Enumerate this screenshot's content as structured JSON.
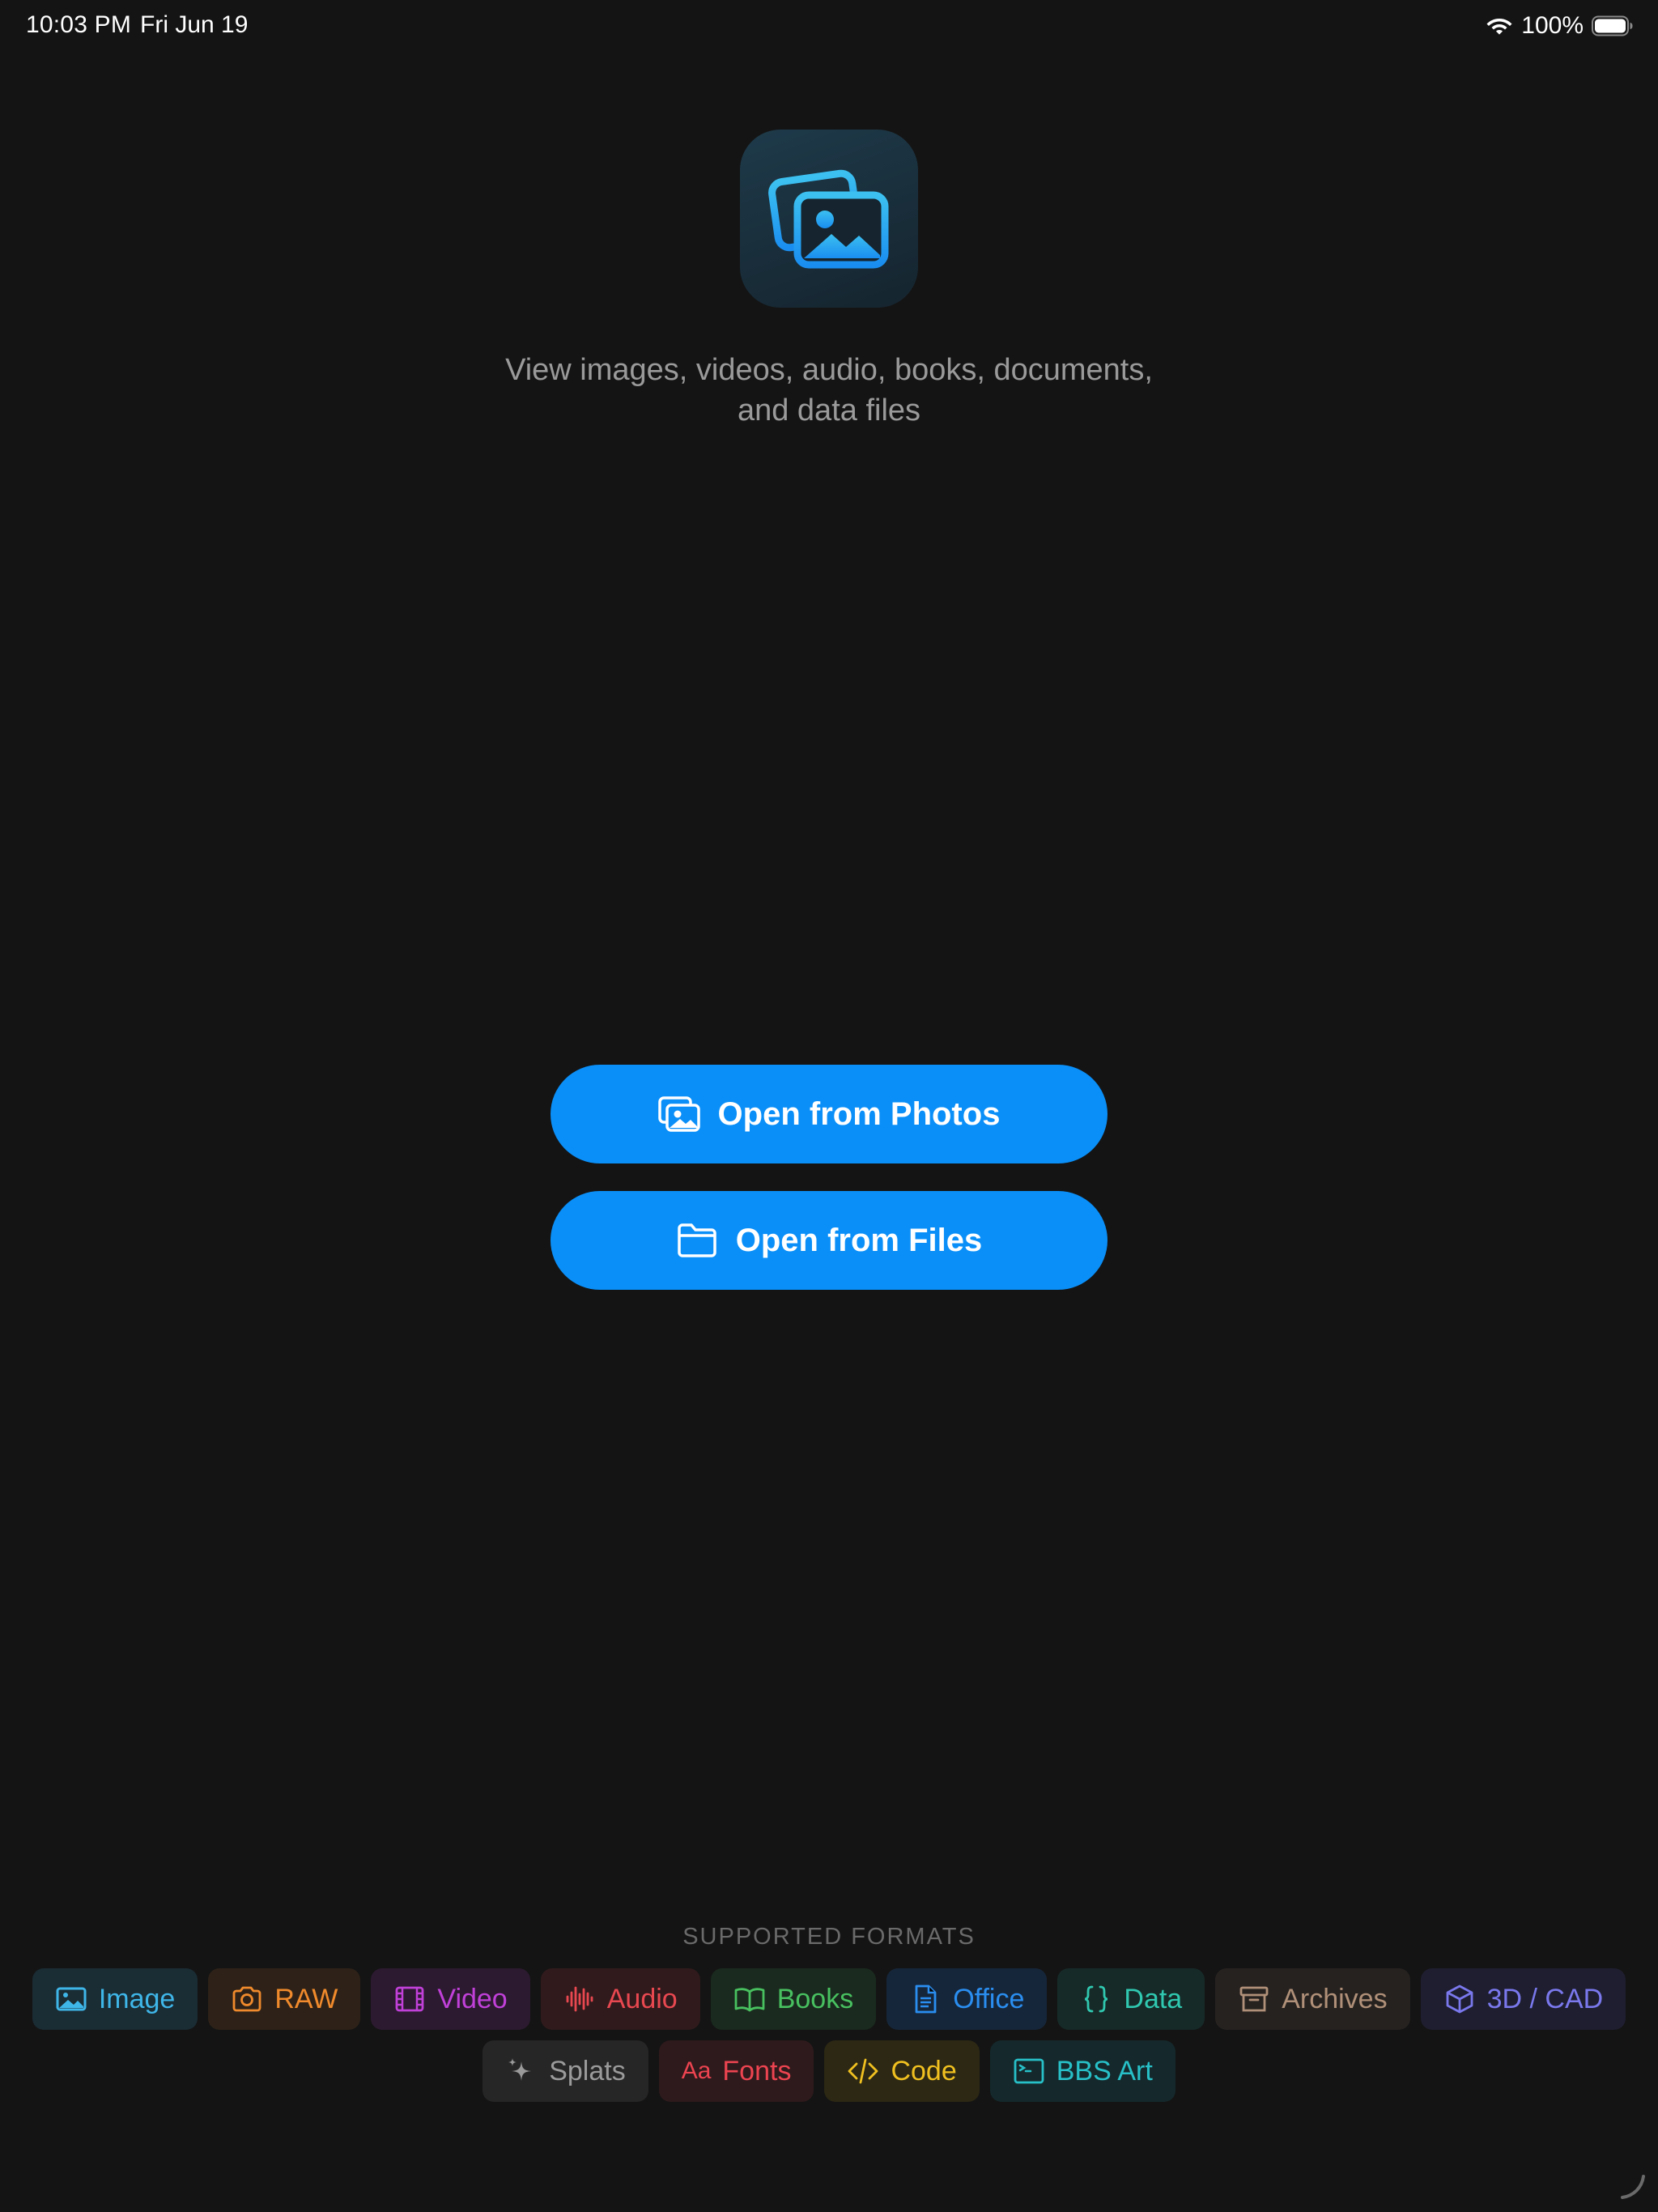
{
  "status_bar": {
    "time": "10:03 PM",
    "date": "Fri Jun 19",
    "battery_percent": "100%",
    "wifi_icon": "wifi-icon",
    "battery_icon": "battery-icon"
  },
  "app": {
    "icon": "photos-stack-icon",
    "tagline_line1": "View images, videos, audio, books, documents,",
    "tagline_line2": "and data files"
  },
  "actions": {
    "open_photos_label": "Open from Photos",
    "open_photos_icon": "photo-stack-icon",
    "open_files_label": "Open from Files",
    "open_files_icon": "folder-icon",
    "accent_color": "#0a8ff8"
  },
  "formats": {
    "title": "SUPPORTED FORMATS",
    "items": [
      {
        "label": "Image",
        "icon": "photo-icon",
        "color": "#3fb6e8",
        "bg": "#1a2c34"
      },
      {
        "label": "RAW",
        "icon": "camera-icon",
        "color": "#f08a2c",
        "bg": "#2e2218"
      },
      {
        "label": "Video",
        "icon": "film-icon",
        "color": "#c040d8",
        "bg": "#2c1a30"
      },
      {
        "label": "Audio",
        "icon": "waveform-icon",
        "color": "#e84850",
        "bg": "#301a1c"
      },
      {
        "label": "Books",
        "icon": "book-icon",
        "color": "#48c060",
        "bg": "#1a2a1e"
      },
      {
        "label": "Office",
        "icon": "document-icon",
        "color": "#2a8ef0",
        "bg": "#16263a"
      },
      {
        "label": "Data",
        "icon": "braces-icon",
        "color": "#30c8b0",
        "bg": "#162a28"
      },
      {
        "label": "Archives",
        "icon": "archive-box-icon",
        "color": "#b09078",
        "bg": "#262220"
      },
      {
        "label": "3D / CAD",
        "icon": "cube-icon",
        "color": "#7a78ec",
        "bg": "#1e1e30"
      },
      {
        "label": "Splats",
        "icon": "sparkles-icon",
        "color": "#9a9a9a",
        "bg": "#262626"
      },
      {
        "label": "Fonts",
        "icon": "text-aa-icon",
        "color": "#ec4450",
        "bg": "#2e1a1c"
      },
      {
        "label": "Code",
        "icon": "code-icon",
        "color": "#f0c020",
        "bg": "#2c2814"
      },
      {
        "label": "BBS Art",
        "icon": "terminal-icon",
        "color": "#28c0c8",
        "bg": "#15292c"
      }
    ]
  }
}
